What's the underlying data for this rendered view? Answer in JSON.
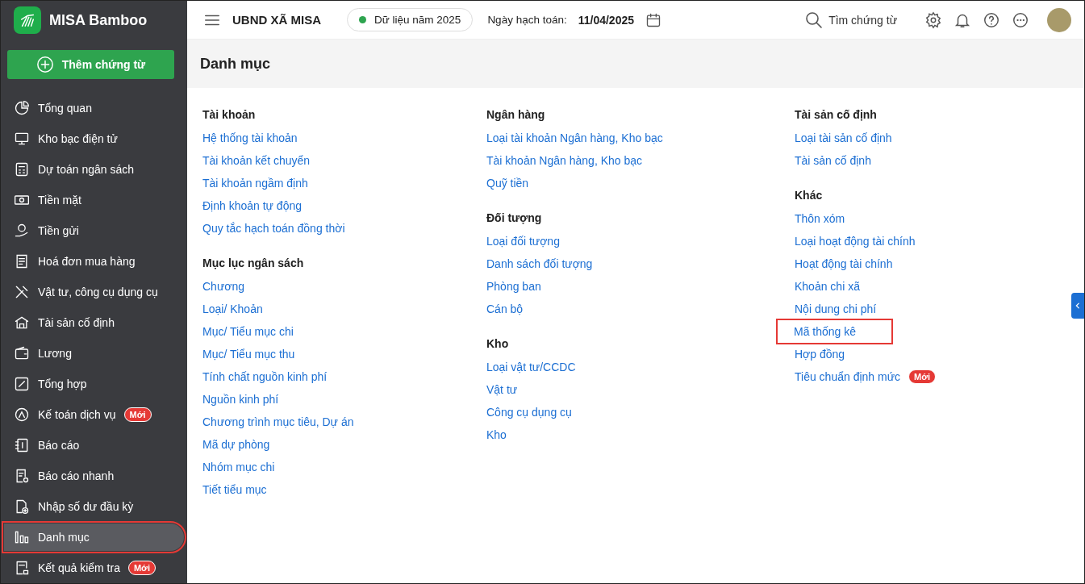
{
  "app": {
    "name": "MISA Bamboo",
    "add_button": "Thêm chứng từ"
  },
  "sidebar": {
    "items": [
      {
        "label": "Tổng quan",
        "selected": false,
        "highlighted": false
      },
      {
        "label": "Kho bạc điện tử",
        "selected": false,
        "highlighted": false
      },
      {
        "label": "Dự toán ngân sách",
        "selected": false,
        "highlighted": false
      },
      {
        "label": "Tiền mặt",
        "selected": false,
        "highlighted": false
      },
      {
        "label": "Tiền gửi",
        "selected": false,
        "highlighted": false
      },
      {
        "label": "Hoá đơn mua hàng",
        "selected": false,
        "highlighted": false
      },
      {
        "label": "Vật tư, công cụ dụng cụ",
        "selected": false,
        "highlighted": false
      },
      {
        "label": "Tài sản cố định",
        "selected": false,
        "highlighted": false
      },
      {
        "label": "Lương",
        "selected": false,
        "highlighted": false
      },
      {
        "label": "Tổng hợp",
        "selected": false,
        "highlighted": false
      },
      {
        "label": "Kế toán dịch vụ",
        "badge": "Mới",
        "selected": false,
        "highlighted": false
      },
      {
        "label": "Báo cáo",
        "selected": false,
        "highlighted": false
      },
      {
        "label": "Báo cáo nhanh",
        "selected": false,
        "highlighted": false
      },
      {
        "label": "Nhập số dư đầu kỳ",
        "selected": false,
        "highlighted": false
      },
      {
        "label": "Danh mục",
        "selected": true,
        "highlighted": true
      },
      {
        "label": "Kết quả kiểm tra",
        "badge": "Mới",
        "selected": false,
        "highlighted": false
      }
    ]
  },
  "topbar": {
    "organization": "UBND XÃ MISA",
    "data_year": "Dữ liệu năm 2025",
    "date_label": "Ngày hạch toán:",
    "date": "11/04/2025",
    "search": "Tìm chứng từ"
  },
  "page": {
    "title": "Danh mục",
    "columns": [
      [
        {
          "title": "Tài khoản",
          "items": [
            {
              "label": "Hệ thống tài khoản",
              "highlighted": false
            },
            {
              "label": "Tài khoản kết chuyển",
              "highlighted": false
            },
            {
              "label": "Tài khoản ngầm định",
              "highlighted": false
            },
            {
              "label": "Định khoản tự động",
              "highlighted": false
            },
            {
              "label": "Quy tắc hạch toán đồng thời",
              "highlighted": false
            }
          ]
        },
        {
          "title": "Mục lục ngân sách",
          "items": [
            {
              "label": "Chương",
              "highlighted": false
            },
            {
              "label": "Loại/ Khoản",
              "highlighted": false
            },
            {
              "label": "Mục/ Tiểu mục chi",
              "highlighted": false
            },
            {
              "label": "Mục/ Tiểu mục thu",
              "highlighted": false
            },
            {
              "label": "Tính chất nguồn kinh phí",
              "highlighted": false
            },
            {
              "label": "Nguồn kinh phí",
              "highlighted": false
            },
            {
              "label": "Chương trình mục tiêu, Dự án",
              "highlighted": false
            },
            {
              "label": "Mã dự phòng",
              "highlighted": false
            },
            {
              "label": "Nhóm mục chi",
              "highlighted": false
            },
            {
              "label": "Tiết tiểu mục",
              "highlighted": false
            }
          ]
        }
      ],
      [
        {
          "title": "Ngân hàng",
          "items": [
            {
              "label": "Loại tài khoản Ngân hàng, Kho bạc",
              "highlighted": false
            },
            {
              "label": "Tài khoản Ngân hàng, Kho bạc",
              "highlighted": false
            },
            {
              "label": "Quỹ tiền",
              "highlighted": false
            }
          ]
        },
        {
          "title": "Đối tượng",
          "items": [
            {
              "label": "Loại đối tượng",
              "highlighted": false
            },
            {
              "label": "Danh sách đối tượng",
              "highlighted": false
            },
            {
              "label": "Phòng ban",
              "highlighted": false
            },
            {
              "label": "Cán bộ",
              "highlighted": false
            }
          ]
        },
        {
          "title": "Kho",
          "items": [
            {
              "label": "Loại vật tư/CCDC",
              "highlighted": false
            },
            {
              "label": "Vật tư",
              "highlighted": false
            },
            {
              "label": "Công cụ dụng cụ",
              "highlighted": false
            },
            {
              "label": "Kho",
              "highlighted": false
            }
          ]
        }
      ],
      [
        {
          "title": "Tài sản cố định",
          "items": [
            {
              "label": "Loại tài sản cố định",
              "highlighted": false
            },
            {
              "label": "Tài sản cố định",
              "highlighted": false
            }
          ]
        },
        {
          "title": "Khác",
          "items": [
            {
              "label": "Thôn xóm",
              "highlighted": false
            },
            {
              "label": "Loại hoạt động tài chính",
              "highlighted": false
            },
            {
              "label": "Hoạt động tài chính",
              "highlighted": false
            },
            {
              "label": "Khoản chi xã",
              "highlighted": false
            },
            {
              "label": "Nội dung chi phí",
              "highlighted": false
            },
            {
              "label": "Mã thống kê",
              "highlighted": true
            },
            {
              "label": "Hợp đồng",
              "highlighted": false
            },
            {
              "label": "Tiêu chuẩn định mức",
              "badge": "Mới",
              "highlighted": false
            }
          ]
        }
      ]
    ]
  }
}
